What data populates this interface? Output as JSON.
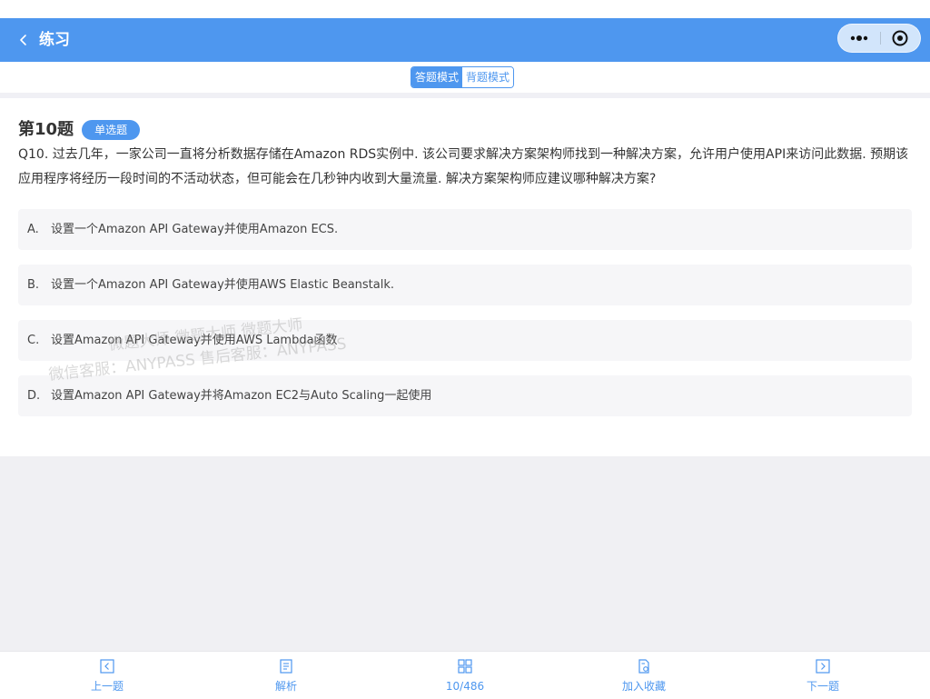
{
  "nav": {
    "title": "练习",
    "back_icon": "chevron-left-icon",
    "more_icon": "more-dots-icon",
    "close_icon": "target-circle-icon",
    "bar_color": "#4e97ef"
  },
  "mode_switch": {
    "modes": [
      {
        "label": "答题模式",
        "active": true
      },
      {
        "label": "背题模式",
        "active": false
      }
    ]
  },
  "question": {
    "number_label": "第10题",
    "type_badge": "单选题",
    "text": "Q10. 过去几年，一家公司一直将分析数据存储在Amazon RDS实例中. 该公司要求解决方案架构师找到一种解决方案，允许用户使用API来访问此数据. 预期该应用程序将经历一段时间的不活动状态，但可能会在几秒钟内收到大量流量. 解决方案架构师应建议哪种解决方案?",
    "options": [
      {
        "letter": "A.",
        "text": "设置一个Amazon API Gateway并使用Amazon ECS."
      },
      {
        "letter": "B.",
        "text": "设置一个Amazon API Gateway并使用AWS Elastic Beanstalk."
      },
      {
        "letter": "C.",
        "text": "设置Amazon API Gateway并使用AWS Lambda函数"
      },
      {
        "letter": "D.",
        "text": "设置Amazon API Gateway并将Amazon EC2与Auto Scaling一起使用"
      }
    ]
  },
  "watermark": {
    "line1": "微题大师 微题大师 微题大师",
    "line2": "微信客服：ANYPASS 售后客服：ANYPASS"
  },
  "tabbar": {
    "accent_color": "#4e97ef",
    "items": [
      {
        "label": "上一题",
        "icon": "prev-square-icon"
      },
      {
        "label": "解析",
        "icon": "document-icon"
      },
      {
        "label": "10/486",
        "icon": "grid-icon"
      },
      {
        "label": "加入收藏",
        "icon": "favorite-doc-icon"
      },
      {
        "label": "下一题",
        "icon": "next-square-icon"
      }
    ]
  }
}
